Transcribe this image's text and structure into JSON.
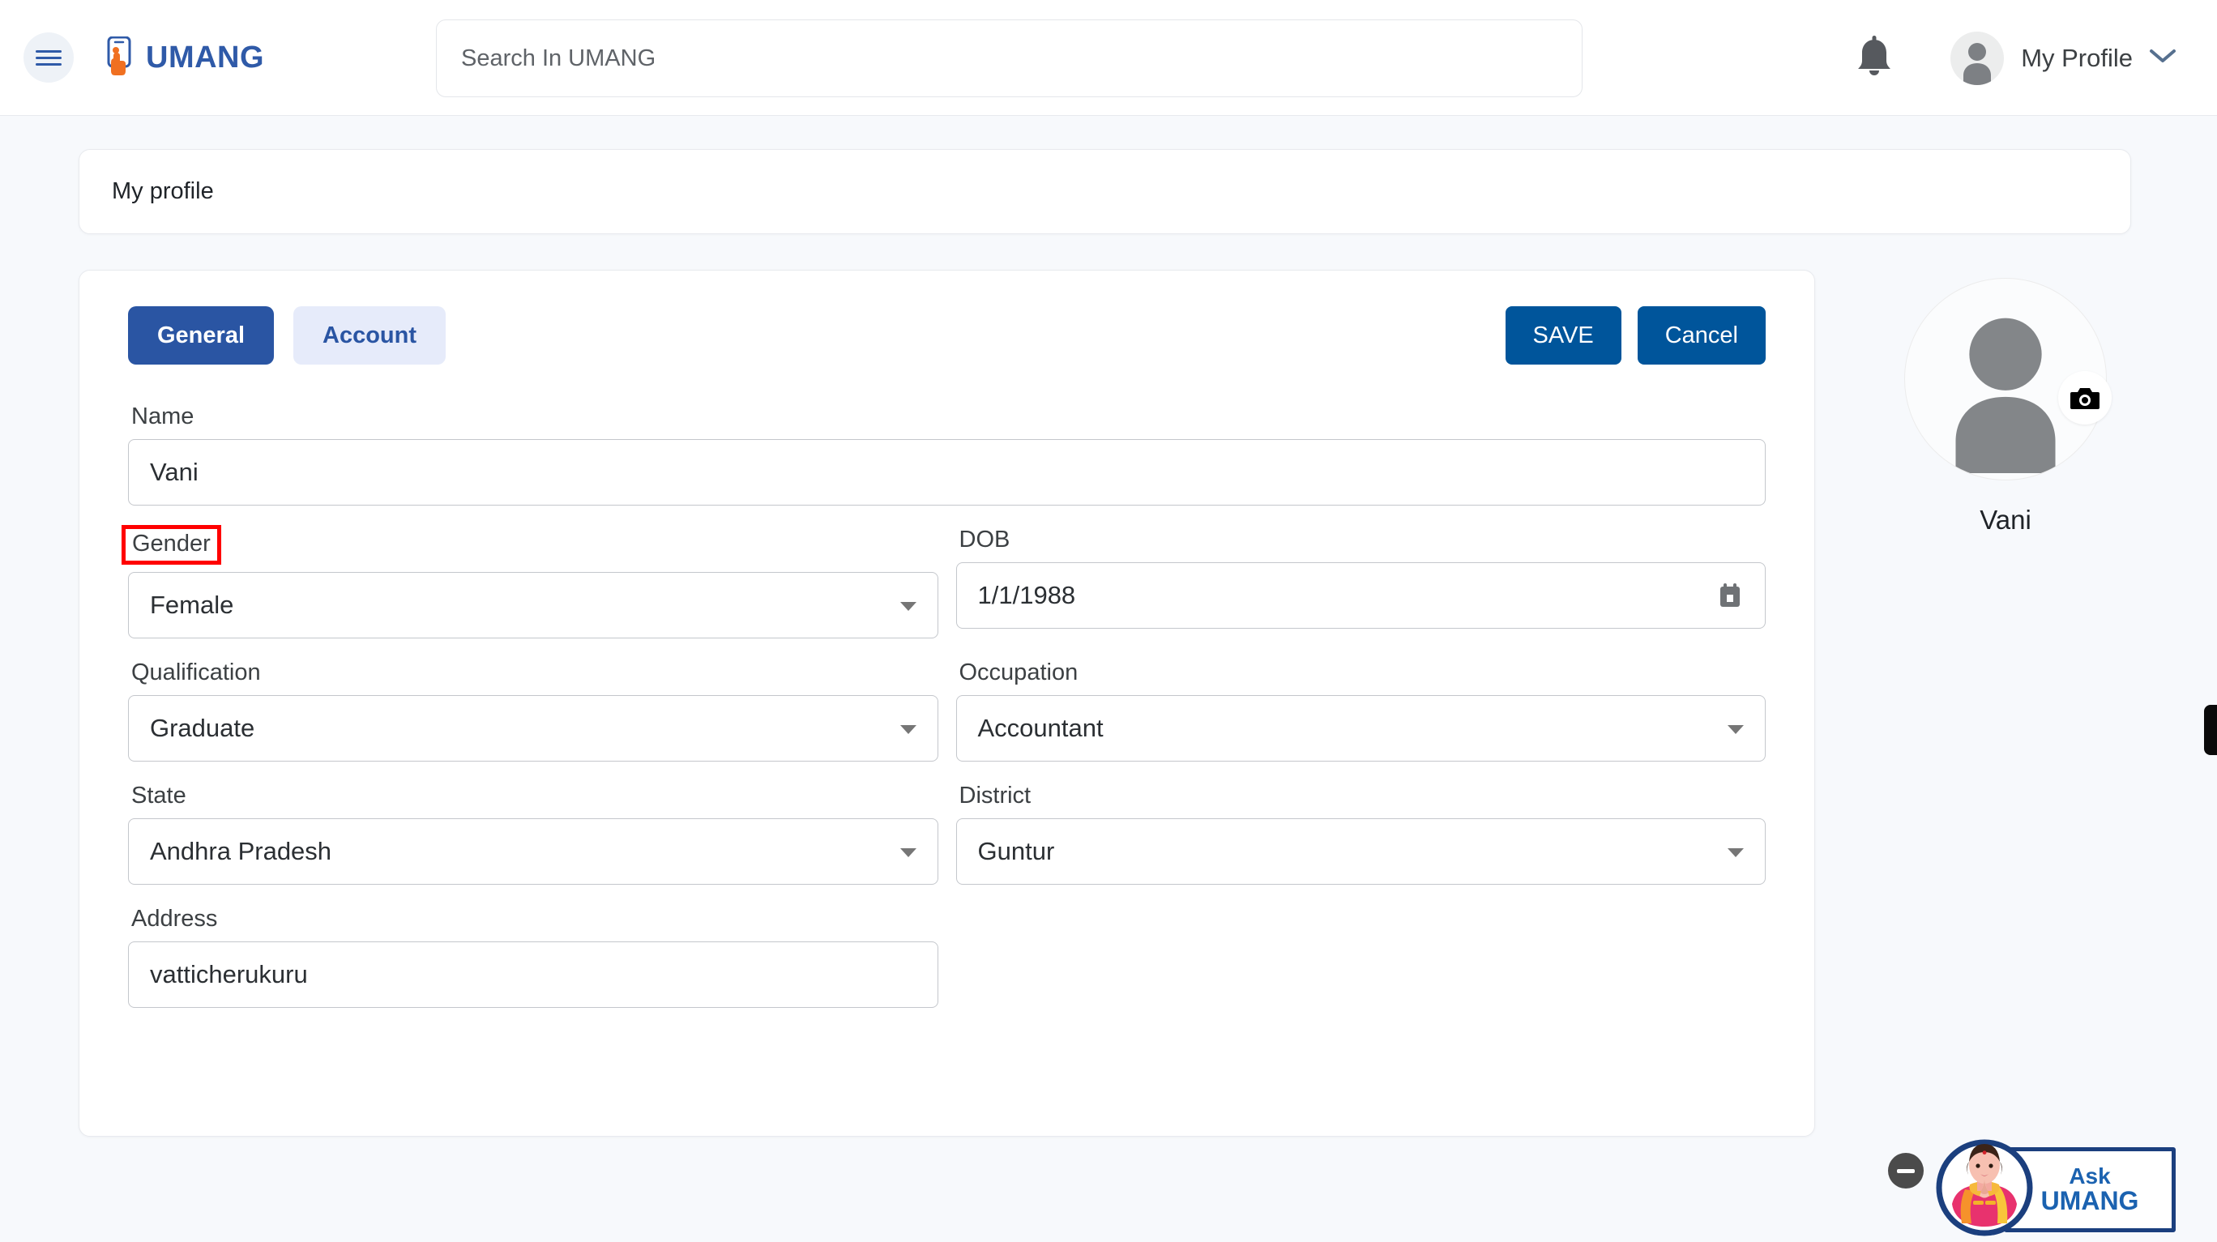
{
  "topbar": {
    "menu_icon": "hamburger-icon",
    "brand": "UMANG",
    "search": {
      "value": "",
      "placeholder": "Search In UMANG"
    },
    "notification_icon": "bell-icon",
    "profile_label": "My Profile",
    "profile_chevron_icon": "chevron-down-icon"
  },
  "page": {
    "title": "My profile"
  },
  "form": {
    "tabs": [
      {
        "label": "General",
        "active": true
      },
      {
        "label": "Account",
        "active": false
      }
    ],
    "save_label": "SAVE",
    "cancel_label": "Cancel",
    "fields": {
      "name": {
        "label": "Name",
        "value": "Vani"
      },
      "gender": {
        "label": "Gender",
        "value": "Female",
        "highlighted": true
      },
      "dob": {
        "label": "DOB",
        "value": "1/1/1988",
        "icon": "calendar-icon"
      },
      "qualification": {
        "label": "Qualification",
        "value": "Graduate"
      },
      "occupation": {
        "label": "Occupation",
        "value": "Accountant"
      },
      "state": {
        "label": "State",
        "value": "Andhra Pradesh"
      },
      "district": {
        "label": "District",
        "value": "Guntur"
      },
      "address": {
        "label": "Address",
        "value": "vatticherukuru"
      }
    }
  },
  "profile_panel": {
    "name": "Vani",
    "avatar_icon": "person-avatar-icon",
    "camera_icon": "camera-icon"
  },
  "chat_widget": {
    "line1": "Ask",
    "line2": "UMANG",
    "minimize_icon": "minimize-icon",
    "avatar_icon": "namaste-woman-avatar-icon"
  },
  "edge_tab": {
    "name": "right-edge-handle"
  },
  "colors": {
    "brand_blue": "#2f5aa8",
    "brand_orange": "#f07021",
    "tab_active_bg": "#2a55a3",
    "tab_inactive_bg": "#e6ebfa",
    "button_blue": "#00559b",
    "highlight_red": "#ff0000",
    "page_bg": "#f7f9fc"
  }
}
